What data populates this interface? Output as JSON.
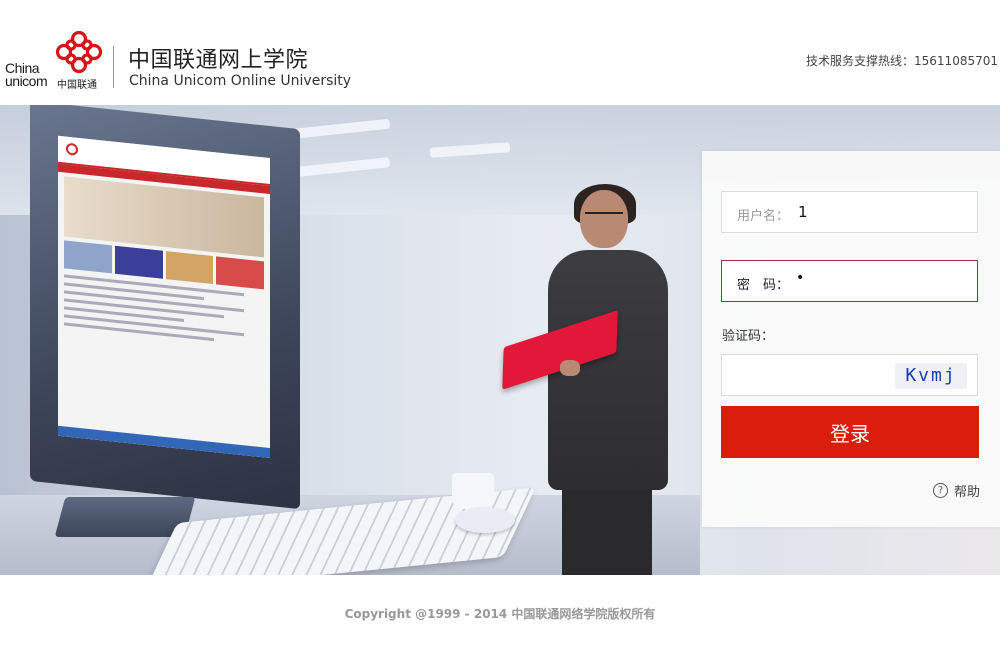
{
  "header": {
    "logo_en_line1": "China",
    "logo_en_line2": "unicom",
    "logo_cn": "中国联通",
    "title_cn": "中国联通网上学院",
    "title_en": "China Unicom Online University",
    "hotline_label": "技术服务支撑热线：",
    "hotline_number": "15611085701"
  },
  "login": {
    "username_label": "用户名：",
    "username_value": "1",
    "password_label": "密　码：",
    "password_value": "•",
    "captcha_label": "验证码：",
    "captcha_text": "Kvmj",
    "submit_label": "登录",
    "help_label": "帮助",
    "help_icon": "question-circle-icon"
  },
  "footer": {
    "copyright": "Copyright @1999 - 2014 中国联通网络学院版权所有"
  },
  "colors": {
    "brand_red": "#da1e0b",
    "active_border": "#a0303c",
    "captcha_blue": "#1b3cb4"
  }
}
